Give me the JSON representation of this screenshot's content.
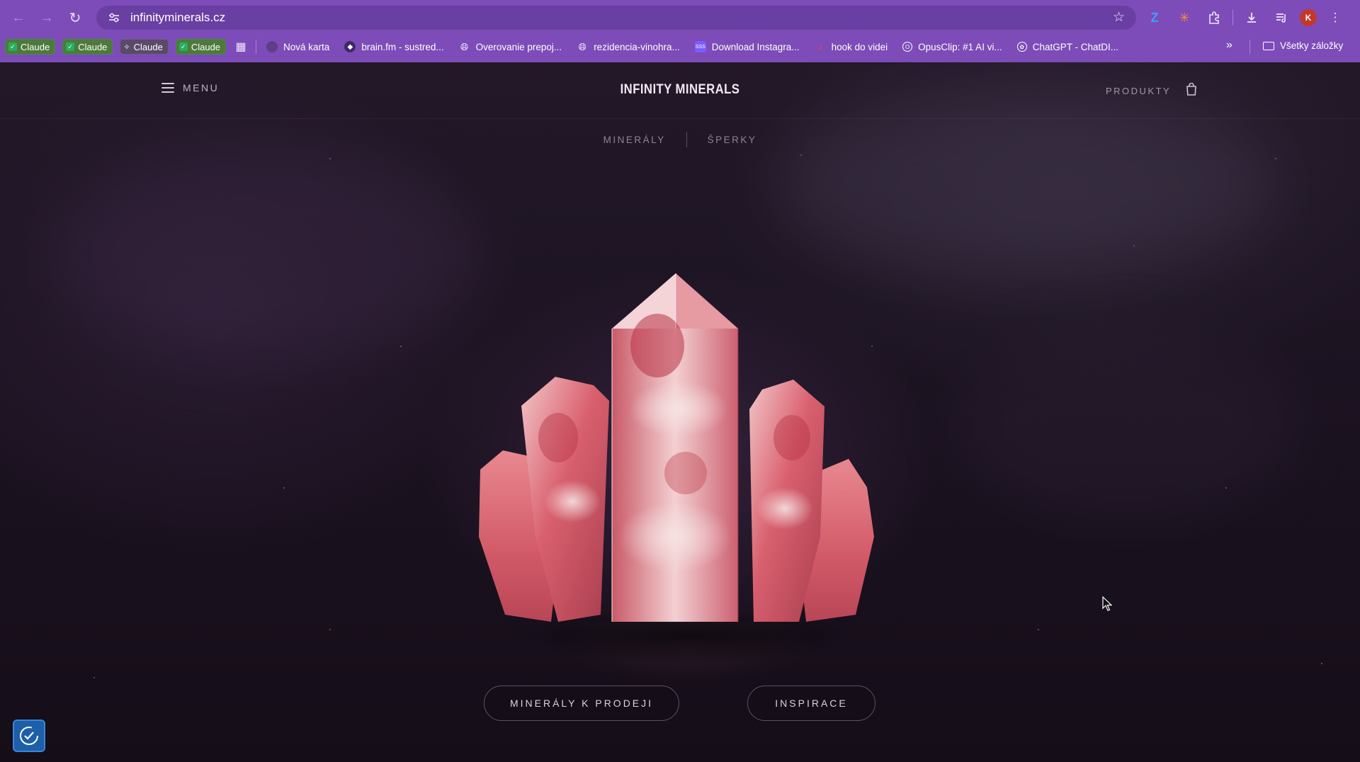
{
  "browser": {
    "url": "infinityminerals.cz",
    "profile_initial": "K",
    "tab_groups": [
      {
        "label": "Claude",
        "style": "green"
      },
      {
        "label": "Claude",
        "style": "green"
      },
      {
        "label": "Claude",
        "style": "grey"
      },
      {
        "label": "Claude",
        "style": "green"
      }
    ],
    "bookmarks": [
      {
        "label": "Nová karta",
        "icon": "new-tab-icon"
      },
      {
        "label": "brain.fm - sustred...",
        "icon": "brainfm-icon"
      },
      {
        "label": "Overovanie prepoj...",
        "icon": "globe-icon"
      },
      {
        "label": "rezidencia-vinohra...",
        "icon": "globe-icon"
      },
      {
        "label": "Download Instagra...",
        "icon": "instagram-downloader-icon"
      },
      {
        "label": "hook do videi",
        "icon": "tiktok-icon"
      },
      {
        "label": "OpusClip: #1 AI vi...",
        "icon": "opusclip-icon"
      },
      {
        "label": "ChatGPT - ChatDI...",
        "icon": "chatgpt-icon"
      }
    ],
    "all_bookmarks_label": "Všetky záložky"
  },
  "site": {
    "menu_label": "MENU",
    "logo": "INFINITY MINERALS",
    "products_label": "PRODUKTY",
    "subnav": {
      "minerals": "MINERÁLY",
      "jewelry": "ŠPERKY"
    },
    "cta_primary": "MINERÁLY K PRODEJI",
    "cta_secondary": "INSPIRACE"
  },
  "colors": {
    "chrome": "#7d4cb8",
    "page_bg": "#1b1220",
    "crystal": "#e0707a"
  }
}
